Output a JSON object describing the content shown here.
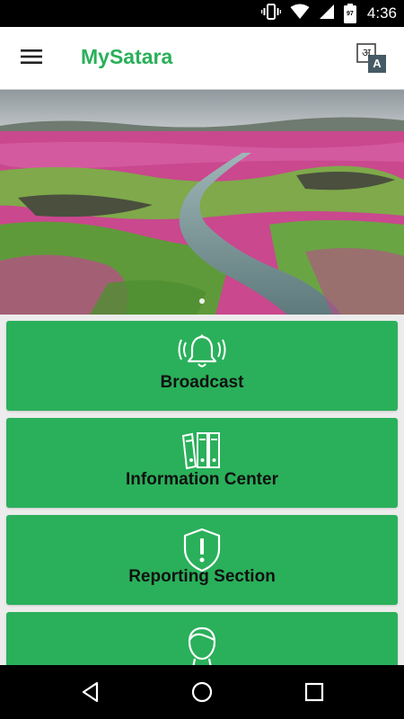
{
  "status_bar": {
    "time": "4:36",
    "battery_level": "97",
    "icons": [
      "vibrate-icon",
      "wifi-icon",
      "signal-icon",
      "battery-icon"
    ]
  },
  "app_bar": {
    "title": "MySatara",
    "menu_icon": "hamburger-menu-icon",
    "translate_icon": "translate-icon",
    "translate_glyph_primary": "अ",
    "translate_glyph_secondary": "A"
  },
  "banner": {
    "carousel_pages": 1,
    "active_page": 1
  },
  "tiles": [
    {
      "label": "Broadcast",
      "icon": "bell-ringing-icon"
    },
    {
      "label": "Information Center",
      "icon": "binders-icon"
    },
    {
      "label": "Reporting Section",
      "icon": "shield-alert-icon"
    },
    {
      "label": "",
      "icon": "person-icon"
    }
  ],
  "colors": {
    "accent": "#2ab05a",
    "tile_text": "#111111",
    "page_background": "#ececec"
  },
  "nav_bar": {
    "buttons": [
      "back-icon",
      "home-icon",
      "recents-icon"
    ]
  }
}
